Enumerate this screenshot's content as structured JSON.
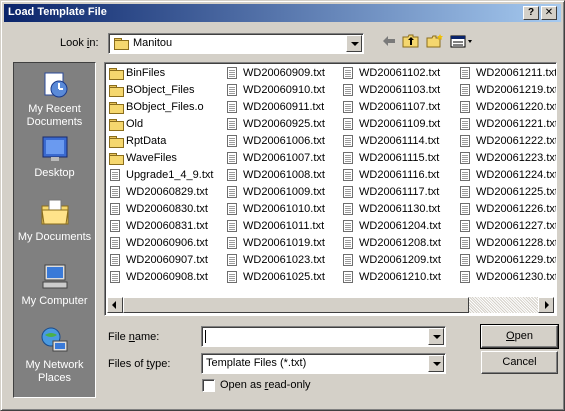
{
  "dialog": {
    "title": "Load Template File",
    "help_glyph": "?",
    "close_glyph": "✕"
  },
  "lookin": {
    "label": "Look in:",
    "value": "Manitou"
  },
  "places": [
    {
      "label": "My Recent Documents",
      "icon": "recent-documents-icon"
    },
    {
      "label": "Desktop",
      "icon": "desktop-icon"
    },
    {
      "label": "My Documents",
      "icon": "my-documents-icon"
    },
    {
      "label": "My Computer",
      "icon": "my-computer-icon"
    },
    {
      "label": "My Network Places",
      "icon": "network-places-icon"
    }
  ],
  "files": {
    "col1": [
      {
        "name": "BinFiles",
        "type": "folder"
      },
      {
        "name": "BObject_Files",
        "type": "folder"
      },
      {
        "name": "BObject_Files.o",
        "type": "folder"
      },
      {
        "name": "Old",
        "type": "folder"
      },
      {
        "name": "RptData",
        "type": "folder"
      },
      {
        "name": "WaveFiles",
        "type": "folder"
      },
      {
        "name": "Upgrade1_4_9.txt",
        "type": "txt"
      },
      {
        "name": "WD20060829.txt",
        "type": "txt"
      },
      {
        "name": "WD20060830.txt",
        "type": "txt"
      },
      {
        "name": "WD20060831.txt",
        "type": "txt"
      },
      {
        "name": "WD20060906.txt",
        "type": "txt"
      },
      {
        "name": "WD20060907.txt",
        "type": "txt"
      },
      {
        "name": "WD20060908.txt",
        "type": "txt"
      }
    ],
    "col2": [
      "WD20060909.txt",
      "WD20060910.txt",
      "WD20060911.txt",
      "WD20060925.txt",
      "WD20061006.txt",
      "WD20061007.txt",
      "WD20061008.txt",
      "WD20061009.txt",
      "WD20061010.txt",
      "WD20061011.txt",
      "WD20061019.txt",
      "WD20061023.txt",
      "WD20061025.txt"
    ],
    "col3": [
      "WD20061102.txt",
      "WD20061103.txt",
      "WD20061107.txt",
      "WD20061109.txt",
      "WD20061114.txt",
      "WD20061115.txt",
      "WD20061116.txt",
      "WD20061117.txt",
      "WD20061130.txt",
      "WD20061204.txt",
      "WD20061208.txt",
      "WD20061209.txt",
      "WD20061210.txt"
    ],
    "col4": [
      "WD20061211.txt",
      "WD20061219.txt",
      "WD20061220.txt",
      "WD20061221.txt",
      "WD20061222.txt",
      "WD20061223.txt",
      "WD20061224.txt",
      "WD20061225.txt",
      "WD20061226.txt",
      "WD20061227.txt",
      "WD20061228.txt",
      "WD20061229.txt",
      "WD20061230.txt"
    ]
  },
  "form": {
    "filename_label_pre": "File ",
    "filename_label_u": "n",
    "filename_label_post": "ame:",
    "filename_value": "",
    "filetype_label_pre": "Files of ",
    "filetype_label_u": "t",
    "filetype_label_post": "ype:",
    "filetype_value": "Template Files (*.txt)",
    "readonly_label_pre": "Open as ",
    "readonly_label_u": "r",
    "readonly_label_post": "ead-only",
    "readonly_checked": false
  },
  "buttons": {
    "open_u": "O",
    "open_rest": "pen",
    "cancel": "Cancel"
  },
  "colors": {
    "title_gradient_start": "#0a246a",
    "title_gradient_end": "#a6caf0",
    "places_bg": "#808080",
    "face": "#d4d0c8"
  }
}
